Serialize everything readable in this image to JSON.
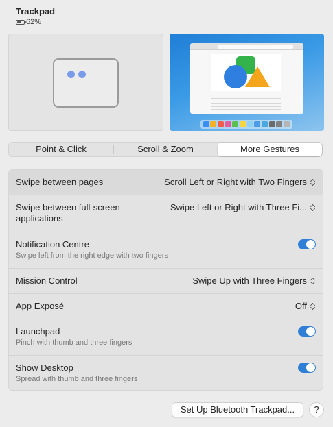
{
  "header": {
    "title": "Trackpad",
    "battery_level": "62%",
    "battery_fraction": 0.62
  },
  "tabs": [
    {
      "label": "Point & Click",
      "active": false
    },
    {
      "label": "Scroll & Zoom",
      "active": false
    },
    {
      "label": "More Gestures",
      "active": true
    }
  ],
  "settings": [
    {
      "label": "Swipe between pages",
      "control": "popup",
      "value": "Scroll Left or Right with Two Fingers"
    },
    {
      "label": "Swipe between full-screen applications",
      "control": "popup",
      "value": "Swipe Left or Right with Three Fi..."
    },
    {
      "label": "Notification Centre",
      "description": "Swipe left from the right edge with two fingers",
      "control": "toggle",
      "on": true
    },
    {
      "label": "Mission Control",
      "control": "popup",
      "value": "Swipe Up with Three Fingers"
    },
    {
      "label": "App Exposé",
      "control": "popup",
      "value": "Off"
    },
    {
      "label": "Launchpad",
      "description": "Pinch with thumb and three fingers",
      "control": "toggle",
      "on": true
    },
    {
      "label": "Show Desktop",
      "description": "Spread with thumb and three fingers",
      "control": "toggle",
      "on": true
    }
  ],
  "footer": {
    "bluetooth_button": "Set Up Bluetooth Trackpad...",
    "help_button": "?"
  },
  "colors": {
    "accent": "#2f7fd6",
    "preview_dot": "#7a9ce8",
    "wallpaper": "#1f7ed6"
  },
  "icons": [
    "battery-icon",
    "up-down-chevron-icon",
    "help-icon"
  ]
}
